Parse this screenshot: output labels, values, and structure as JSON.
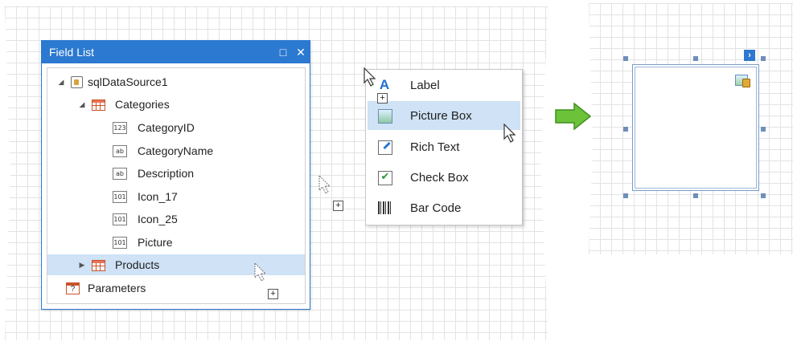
{
  "field_list": {
    "title": "Field List",
    "maximize_glyph": "□",
    "close_glyph": "✕",
    "tree": {
      "datasource": "sqlDataSource1",
      "categories": "Categories",
      "fields": [
        {
          "type_code": "123",
          "name": "CategoryID"
        },
        {
          "type_code": "ab",
          "name": "CategoryName"
        },
        {
          "type_code": "ab",
          "name": "Description"
        },
        {
          "type_code": "101",
          "name": "Icon_17"
        },
        {
          "type_code": "101",
          "name": "Icon_25"
        },
        {
          "type_code": "101",
          "name": "Picture"
        }
      ],
      "products": "Products",
      "parameters": "Parameters",
      "parameters_glyph": "?"
    }
  },
  "popup_menu": {
    "items": [
      {
        "label": "Label",
        "icon": "label-icon",
        "glyph": "A"
      },
      {
        "label": "Picture Box",
        "icon": "picture-icon"
      },
      {
        "label": "Rich Text",
        "icon": "rich-text-icon"
      },
      {
        "label": "Check Box",
        "icon": "check-box-icon",
        "glyph": "✔"
      },
      {
        "label": "Bar Code",
        "icon": "barcode-icon"
      }
    ],
    "highlighted_item": "Picture Box"
  },
  "picture_box": {
    "smart_tag_glyph": "›"
  },
  "cursor_plus_glyph": "+",
  "colors": {
    "accent": "#2b79d0",
    "selection": "#cfe2f6",
    "arrow_green": "#6cc33a"
  }
}
